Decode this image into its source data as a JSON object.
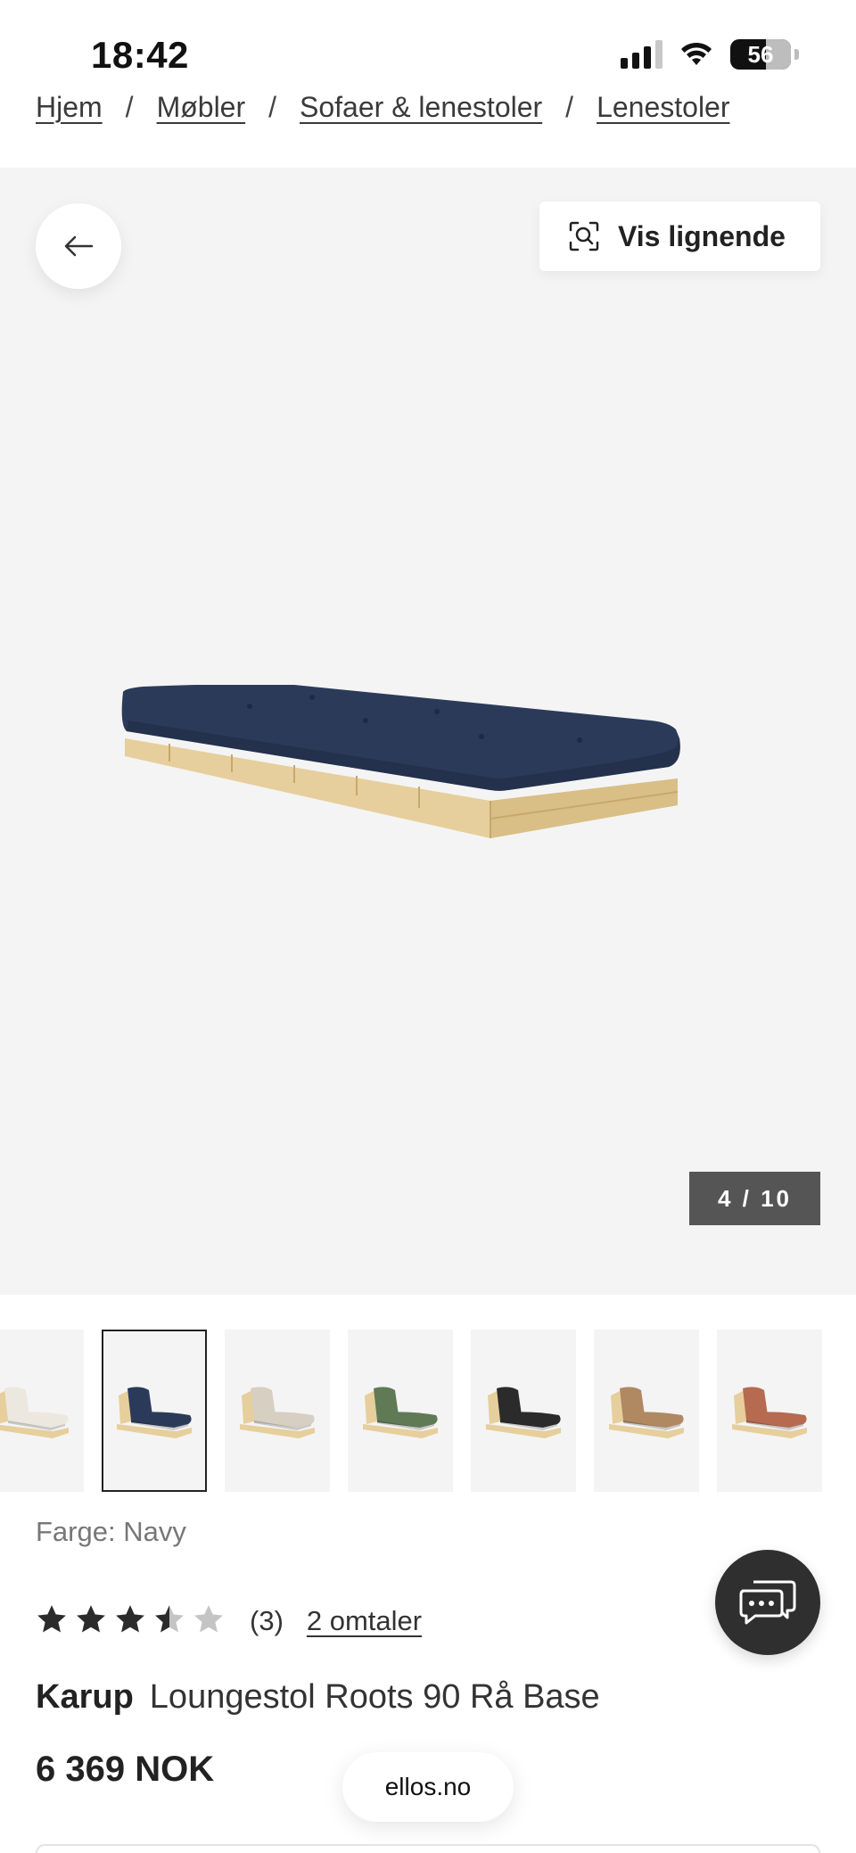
{
  "status_bar": {
    "time": "18:42",
    "battery": "56",
    "icons": [
      "signal-icon",
      "wifi-icon",
      "battery-icon"
    ]
  },
  "breadcrumb": {
    "items": [
      "Hjem",
      "Møbler",
      "Sofaer & lenestoler",
      "Lenestoler"
    ],
    "separator": "/"
  },
  "gallery": {
    "back_icon": "arrow-left-icon",
    "similar_icon": "visual-search-icon",
    "similar_label": "Vis lignende",
    "counter": "4 / 10",
    "current_image": 4,
    "total_images": 10
  },
  "thumbnails": {
    "selected_index": 1,
    "items": [
      {
        "color": "#ece8e0",
        "name": "off-white"
      },
      {
        "color": "#2c3a5a",
        "name": "navy"
      },
      {
        "color": "#d6cfc2",
        "name": "beige"
      },
      {
        "color": "#5f7a55",
        "name": "olive-green"
      },
      {
        "color": "#2b2b2b",
        "name": "black"
      },
      {
        "color": "#b08862",
        "name": "caramel"
      },
      {
        "color": "#b66a4f",
        "name": "rust"
      }
    ]
  },
  "product": {
    "color_label": "Farge: Navy",
    "rating_value": 3.5,
    "rating_max": 5,
    "rating_count": "(3)",
    "reviews_link": "2 omtaler",
    "brand": "Karup",
    "name": "Loungestol Roots 90 Rå Base",
    "price": "6 369 NOK"
  },
  "chat": {
    "icon": "chat-icon"
  },
  "domain": "ellos.no",
  "colors": {
    "gallery_bg": "#f4f4f4",
    "mattress_navy": "#2c3a5a",
    "wood": "#e6cf9c",
    "counter_bg": "#555555",
    "chat_bg": "#2f2f2f"
  }
}
